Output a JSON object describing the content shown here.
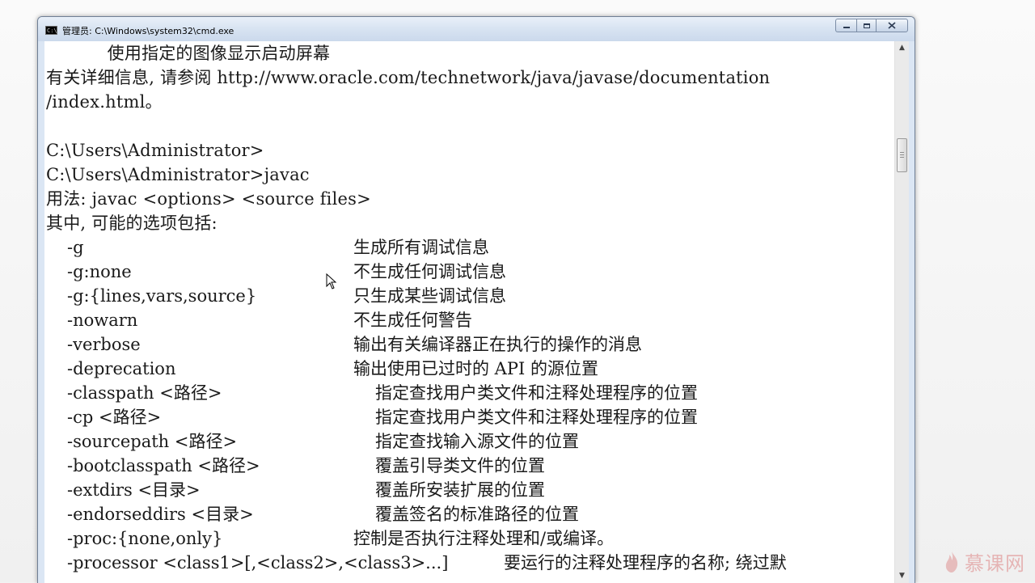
{
  "window": {
    "title": "管理员: C:\\Windows\\system32\\cmd.exe",
    "icon": "console-icon",
    "icon_text": "C:\\"
  },
  "console": {
    "lines": [
      "           使用指定的图像显示启动屏幕",
      "有关详细信息, 请参阅 http://www.oracle.com/technetwork/java/javase/documentation",
      "/index.html。",
      "",
      "C:\\Users\\Administrator>",
      "C:\\Users\\Administrator>javac",
      "用法: javac <options> <source files>",
      "其中, 可能的选项包括:"
    ],
    "options": [
      {
        "name": "-g",
        "desc": "生成所有调试信息"
      },
      {
        "name": "-g:none",
        "desc": "不生成任何调试信息"
      },
      {
        "name": "-g:{lines,vars,source}",
        "desc": "只生成某些调试信息"
      },
      {
        "name": "-nowarn",
        "desc": "不生成任何警告"
      },
      {
        "name": "-verbose",
        "desc": "输出有关编译器正在执行的操作的消息"
      },
      {
        "name": "-deprecation",
        "desc": "输出使用已过时的 API 的源位置"
      },
      {
        "name": "-classpath <路径>",
        "desc": "指定查找用户类文件和注释处理程序的位置"
      },
      {
        "name": "-cp <路径>",
        "desc": "指定查找用户类文件和注释处理程序的位置"
      },
      {
        "name": "-sourcepath <路径>",
        "desc": "指定查找输入源文件的位置"
      },
      {
        "name": "-bootclasspath <路径>",
        "desc": "覆盖引导类文件的位置"
      },
      {
        "name": "-extdirs <目录>",
        "desc": "覆盖所安装扩展的位置"
      },
      {
        "name": "-endorseddirs <目录>",
        "desc": "覆盖签名的标准路径的位置"
      },
      {
        "name": "-proc:{none,only}",
        "desc": "控制是否执行注释处理和/或编译。"
      },
      {
        "name": "-processor <class1>[,<class2>,<class3>...]",
        "desc": "要运行的注释处理程序的名称; 绕过默"
      }
    ]
  },
  "watermark": {
    "text": "慕课网"
  },
  "colors": {
    "console_bg": "#ffffff",
    "console_text": "#1a1a1a",
    "titlebar": "#d6e2f1"
  }
}
